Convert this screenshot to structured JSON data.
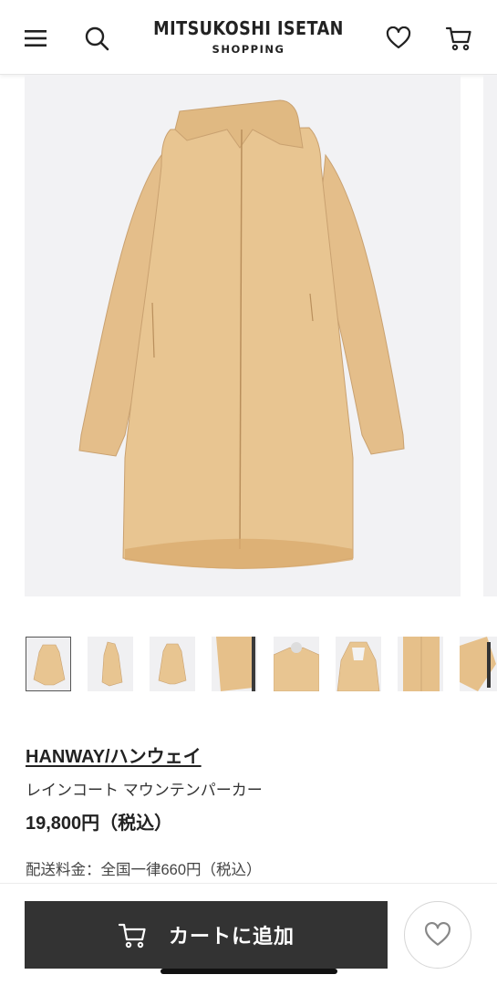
{
  "header": {
    "brand_main": "MITSUKOSHI ISETAN",
    "brand_sub": "SHOPPING",
    "icons": [
      "menu-icon",
      "search-icon",
      "heart-icon",
      "cart-icon"
    ]
  },
  "product": {
    "brand_link": "HANWAY/ハンウェイ",
    "name": "レインコート マウンテンパーカー",
    "price": "19,800円（税込）",
    "shipping": "配送料金：全国一律660円（税込）",
    "image_color": "#e8c591",
    "thumbnail_count": 8,
    "active_thumbnail": 1
  },
  "actions": {
    "add_to_cart_label": "カートに追加",
    "icons": [
      "cart-icon",
      "heart-icon"
    ]
  },
  "colors": {
    "button_bg": "#333333",
    "coat": "#e8c591",
    "image_bg": "#f2f2f4"
  }
}
